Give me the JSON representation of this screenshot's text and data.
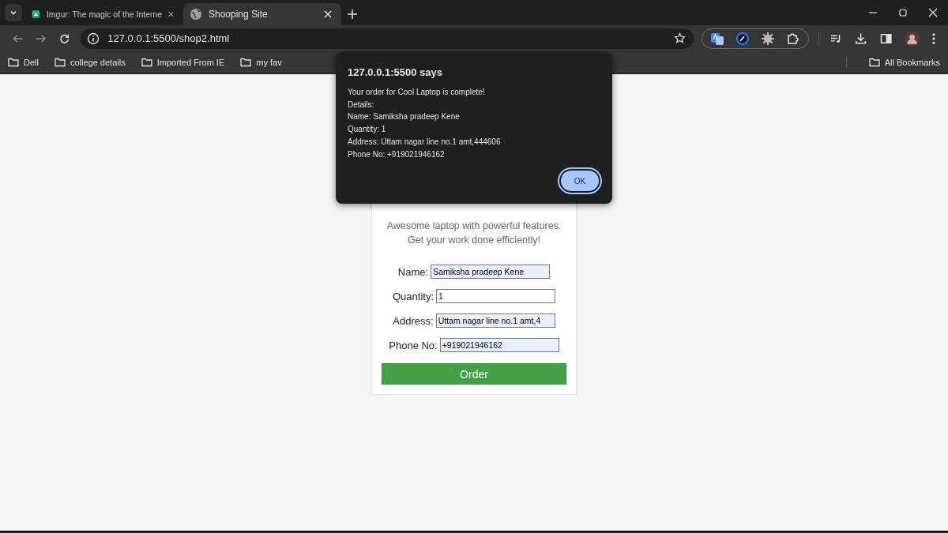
{
  "tabs": [
    {
      "title": "Imgur: The magic of the Interne",
      "kind": "app",
      "selected": false
    },
    {
      "title": "Shooping Site",
      "kind": "web",
      "selected": true
    }
  ],
  "address_bar": {
    "url": "127.0.0.1:5500/shop2.html"
  },
  "bookmarks": [
    {
      "label": "Dell"
    },
    {
      "label": "college details"
    },
    {
      "label": "Imported From IE"
    },
    {
      "label": "my fav"
    }
  ],
  "all_bookmarks": "All Bookmarks",
  "product": {
    "description": "Awesome laptop with powerful features. Get your work done efficiently!"
  },
  "form": {
    "fields": [
      {
        "label": "Name:",
        "value": "Samiksha pradeep Kene",
        "autofilled": true
      },
      {
        "label": "Quantity:",
        "value": "1",
        "autofilled": false
      },
      {
        "label": "Address:",
        "value": "Uttam nagar line no.1 amt,4",
        "autofilled": true
      },
      {
        "label": "Phone No:",
        "value": "+919021946162",
        "autofilled": true
      }
    ],
    "submit": "Order"
  },
  "dialog": {
    "title": "127.0.0.1:5500 says",
    "lines": [
      "Your order for Cool Laptop is complete!",
      "Details:",
      "Name: Samiksha pradeep Kene",
      "Quantity: 1",
      "Address: Uttam nagar line no.1 amt,444606",
      "Phone No: +919021946162"
    ],
    "button": "OK"
  }
}
